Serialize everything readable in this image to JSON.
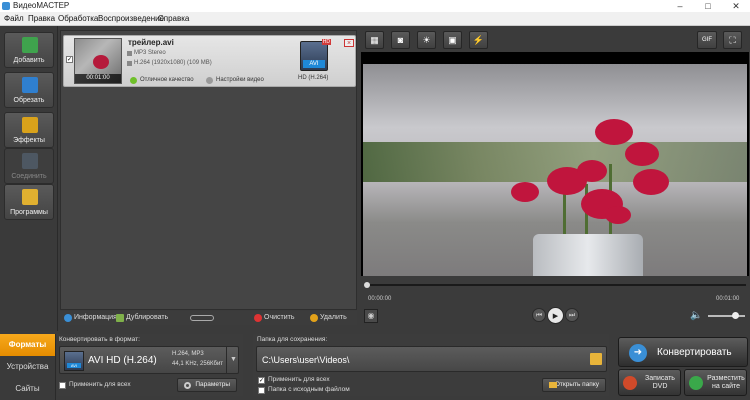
{
  "window": {
    "title": "ВидеоМАСТЕР",
    "minimize": "–",
    "maximize": "□",
    "close": "✕"
  },
  "menu": [
    "Файл",
    "Правка",
    "Обработка",
    "Воспроизведение",
    "Справка"
  ],
  "left_toolbar": [
    {
      "label": "Добавить",
      "icon": "add-file-icon",
      "color": "#3fa34d",
      "enabled": true
    },
    {
      "label": "Обрезать",
      "icon": "cut-icon",
      "color": "#2f7fcf",
      "enabled": true
    },
    {
      "label": "Эффекты",
      "icon": "effects-icon",
      "color": "#d9a21b",
      "enabled": true
    },
    {
      "label": "Соединить",
      "icon": "join-icon",
      "color": "#5c6f86",
      "enabled": false
    },
    {
      "label": "Программы",
      "icon": "programs-icon",
      "color": "#e0b030",
      "enabled": true
    }
  ],
  "file_item": {
    "name": "трейлер.avi",
    "audio": "MP3 Stereo",
    "video": "H.264 (1920x1080) (109 MB)",
    "duration": "00:01:00",
    "quality": "Отличное качество",
    "settings": "Настройки видео",
    "format_badge": "AVI",
    "format_caption": "HD (H.264)",
    "hd_tag": "HD",
    "checked": "✓"
  },
  "list_toolbar": {
    "info": "Информация",
    "duplicate": "Дублировать",
    "clear": "Очистить",
    "delete": "Удалить"
  },
  "video_toolbar": {
    "gif": "GIF"
  },
  "player": {
    "time_current": "00:00:00",
    "time_total": "00:01:00",
    "progress": 0,
    "volume": 0.8
  },
  "bottom_tabs": [
    {
      "label": "Форматы",
      "active": true
    },
    {
      "label": "Устройства",
      "active": false
    },
    {
      "label": "Сайты",
      "active": false
    }
  ],
  "convert": {
    "title": "Конвертировать в формат:",
    "format_name": "AVI HD (H.264)",
    "spec_line1": "H.264, MP3",
    "spec_line2": "44,1 KHz, 256Кбит",
    "mini_badge": "AVI",
    "apply_all": "Применить для всех",
    "params": "Параметры"
  },
  "save": {
    "title": "Папка для сохранения:",
    "path": "C:\\Users\\user\\Videos\\",
    "apply_all": "Применить для всех",
    "source_folder": "Папка с исходным файлом",
    "open_folder": "Открыть папку",
    "apply_checked": "✓"
  },
  "actions": {
    "convert": "Конвертировать",
    "dvd_line1": "Записать",
    "dvd_line2": "DVD",
    "site_line1": "Разместить",
    "site_line2": "на сайте"
  }
}
